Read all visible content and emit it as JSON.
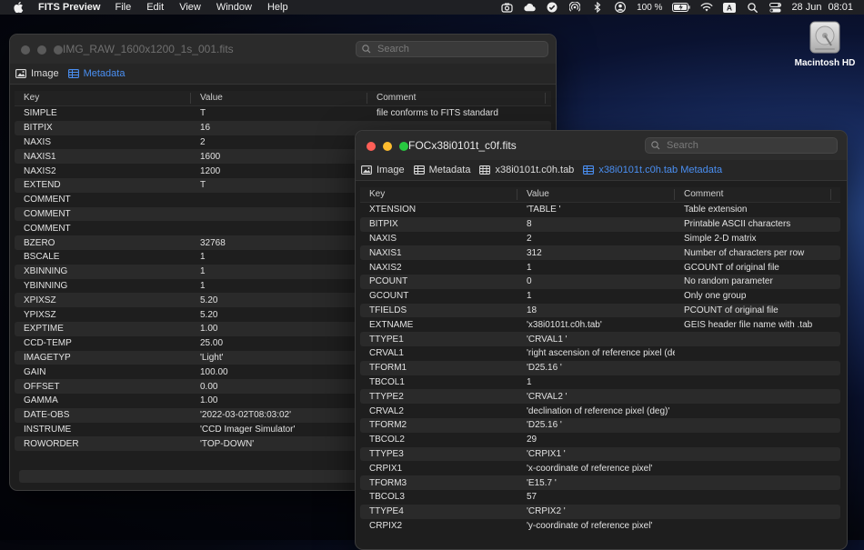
{
  "menubar": {
    "app_name": "FITS Preview",
    "menus": [
      "File",
      "Edit",
      "View",
      "Window",
      "Help"
    ],
    "battery": "100 %",
    "input_source": "A",
    "date": "28 Jun",
    "time": "08:01"
  },
  "desktop": {
    "disk_label": "Macintosh HD"
  },
  "window1": {
    "title": "IMG_RAW_1600x1200_1s_001.fits",
    "search_placeholder": "Search",
    "tabs": [
      {
        "label": "Image",
        "icon": "image-icon",
        "active": false
      },
      {
        "label": "Metadata",
        "icon": "table-icon",
        "active": true
      }
    ],
    "columns": [
      "Key",
      "Value",
      "Comment"
    ],
    "rows": [
      [
        "SIMPLE",
        "T",
        "file conforms to FITS standard"
      ],
      [
        "BITPIX",
        "16",
        ""
      ],
      [
        "NAXIS",
        "2",
        ""
      ],
      [
        "NAXIS1",
        "1600",
        ""
      ],
      [
        "NAXIS2",
        "1200",
        ""
      ],
      [
        "EXTEND",
        "T",
        ""
      ],
      [
        "COMMENT",
        "",
        ""
      ],
      [
        "COMMENT",
        "",
        ""
      ],
      [
        "COMMENT",
        "",
        ""
      ],
      [
        "BZERO",
        "32768",
        ""
      ],
      [
        "BSCALE",
        "1",
        ""
      ],
      [
        "XBINNING",
        "1",
        ""
      ],
      [
        "YBINNING",
        "1",
        ""
      ],
      [
        "XPIXSZ",
        "5.20",
        ""
      ],
      [
        "YPIXSZ",
        "5.20",
        ""
      ],
      [
        "EXPTIME",
        "1.00",
        ""
      ],
      [
        "CCD-TEMP",
        "25.00",
        ""
      ],
      [
        "IMAGETYP",
        "'Light'",
        ""
      ],
      [
        "GAIN",
        "100.00",
        ""
      ],
      [
        "OFFSET",
        "0.00",
        ""
      ],
      [
        "GAMMA",
        "1.00",
        ""
      ],
      [
        "DATE-OBS",
        "'2022-03-02T08:03:02'",
        ""
      ],
      [
        "INSTRUME",
        "'CCD Imager Simulator'",
        ""
      ],
      [
        "ROWORDER",
        "'TOP-DOWN'",
        ""
      ]
    ]
  },
  "window2": {
    "title": "FOCx38i0101t_c0f.fits",
    "search_placeholder": "Search",
    "tabs": [
      {
        "label": "Image",
        "icon": "image-icon",
        "active": false
      },
      {
        "label": "Metadata",
        "icon": "list-icon",
        "active": false
      },
      {
        "label": "x38i0101t.c0h.tab",
        "icon": "table-icon",
        "active": false
      },
      {
        "label": "x38i0101t.c0h.tab Metadata",
        "icon": "table-icon",
        "active": true
      }
    ],
    "columns": [
      "Key",
      "Value",
      "Comment"
    ],
    "rows": [
      [
        "XTENSION",
        "'TABLE   '",
        "Table extension"
      ],
      [
        "BITPIX",
        "8",
        "Printable ASCII characters"
      ],
      [
        "NAXIS",
        "2",
        "Simple 2-D matrix"
      ],
      [
        "NAXIS1",
        "312",
        "Number of characters per row"
      ],
      [
        "NAXIS2",
        "1",
        "GCOUNT of original file"
      ],
      [
        "PCOUNT",
        "0",
        "No random parameter"
      ],
      [
        "GCOUNT",
        "1",
        "Only one group"
      ],
      [
        "TFIELDS",
        "18",
        "PCOUNT of original file"
      ],
      [
        "EXTNAME",
        "'x38i0101t.c0h.tab'",
        "GEIS header file name with .tab"
      ],
      [
        "TTYPE1",
        "'CRVAL1  '",
        ""
      ],
      [
        "CRVAL1",
        "'right ascension of reference pixel (deg)'",
        ""
      ],
      [
        "TFORM1",
        "'D25.16  '",
        ""
      ],
      [
        "TBCOL1",
        "1",
        ""
      ],
      [
        "TTYPE2",
        "'CRVAL2  '",
        ""
      ],
      [
        "CRVAL2",
        "'declination of reference pixel (deg)'",
        ""
      ],
      [
        "TFORM2",
        "'D25.16  '",
        ""
      ],
      [
        "TBCOL2",
        "29",
        ""
      ],
      [
        "TTYPE3",
        "'CRPIX1  '",
        ""
      ],
      [
        "CRPIX1",
        "'x-coordinate of reference pixel'",
        ""
      ],
      [
        "TFORM3",
        "'E15.7   '",
        ""
      ],
      [
        "TBCOL3",
        "57",
        ""
      ],
      [
        "TTYPE4",
        "'CRPIX2  '",
        ""
      ],
      [
        "CRPIX2",
        "'y-coordinate of reference pixel'",
        ""
      ]
    ]
  },
  "colors": {
    "close": "#ff5f57",
    "minimize": "#febc2e",
    "zoom": "#28c840",
    "accent": "#4a8ff2"
  }
}
